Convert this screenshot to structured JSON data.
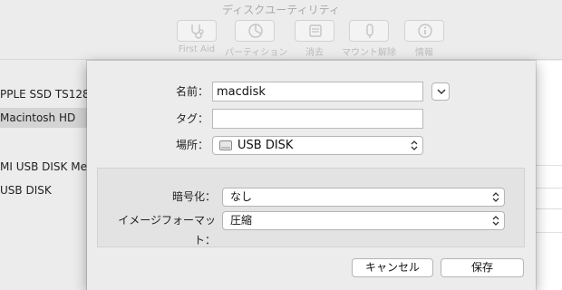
{
  "window": {
    "title": "ディスクユーティリティ"
  },
  "toolbar": {
    "first_aid": "First Aid",
    "partition": "パーティション",
    "erase": "消去",
    "unmount": "マウント解除",
    "info": "情報"
  },
  "sidebar": {
    "items": [
      {
        "label": "PPLE SSD TS128"
      },
      {
        "label": "Macintosh HD"
      },
      {
        "label": "MI USB DISK Med"
      },
      {
        "label": "USB DISK"
      }
    ]
  },
  "dialog": {
    "name_label": "名前：",
    "name_value": "macdisk",
    "tag_label": "タグ：",
    "tag_value": "",
    "location_label": "場所：",
    "location_value": "USB DISK",
    "encryption_label": "暗号化：",
    "encryption_value": "なし",
    "image_format_label": "イメージフォーマット：",
    "image_format_value": "圧縮",
    "cancel_label": "キャンセル",
    "save_label": "保存"
  },
  "icons": {
    "first_aid": "stethoscope-icon",
    "partition": "pie-chart-icon",
    "erase": "erase-icon",
    "unmount": "eject-icon",
    "info": "info-icon",
    "disclosure": "chevron-down-icon",
    "popup_arrows": "updown-arrows-icon",
    "location_disk": "usb-drive-icon"
  },
  "colors": {
    "window_bg": "#ececec",
    "selection": "#d4d4d4",
    "disabled_text": "#bdbdbd"
  }
}
